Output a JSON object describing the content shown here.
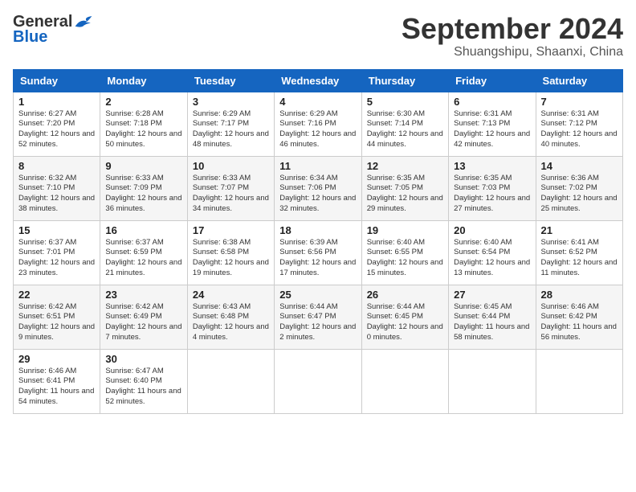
{
  "logo": {
    "general": "General",
    "blue": "Blue"
  },
  "header": {
    "month": "September 2024",
    "location": "Shuangshipu, Shaanxi, China"
  },
  "weekdays": [
    "Sunday",
    "Monday",
    "Tuesday",
    "Wednesday",
    "Thursday",
    "Friday",
    "Saturday"
  ],
  "weeks": [
    [
      {
        "day": "1",
        "sunrise": "6:27 AM",
        "sunset": "7:20 PM",
        "daylight": "12 hours and 52 minutes."
      },
      {
        "day": "2",
        "sunrise": "6:28 AM",
        "sunset": "7:18 PM",
        "daylight": "12 hours and 50 minutes."
      },
      {
        "day": "3",
        "sunrise": "6:29 AM",
        "sunset": "7:17 PM",
        "daylight": "12 hours and 48 minutes."
      },
      {
        "day": "4",
        "sunrise": "6:29 AM",
        "sunset": "7:16 PM",
        "daylight": "12 hours and 46 minutes."
      },
      {
        "day": "5",
        "sunrise": "6:30 AM",
        "sunset": "7:14 PM",
        "daylight": "12 hours and 44 minutes."
      },
      {
        "day": "6",
        "sunrise": "6:31 AM",
        "sunset": "7:13 PM",
        "daylight": "12 hours and 42 minutes."
      },
      {
        "day": "7",
        "sunrise": "6:31 AM",
        "sunset": "7:12 PM",
        "daylight": "12 hours and 40 minutes."
      }
    ],
    [
      {
        "day": "8",
        "sunrise": "6:32 AM",
        "sunset": "7:10 PM",
        "daylight": "12 hours and 38 minutes."
      },
      {
        "day": "9",
        "sunrise": "6:33 AM",
        "sunset": "7:09 PM",
        "daylight": "12 hours and 36 minutes."
      },
      {
        "day": "10",
        "sunrise": "6:33 AM",
        "sunset": "7:07 PM",
        "daylight": "12 hours and 34 minutes."
      },
      {
        "day": "11",
        "sunrise": "6:34 AM",
        "sunset": "7:06 PM",
        "daylight": "12 hours and 32 minutes."
      },
      {
        "day": "12",
        "sunrise": "6:35 AM",
        "sunset": "7:05 PM",
        "daylight": "12 hours and 29 minutes."
      },
      {
        "day": "13",
        "sunrise": "6:35 AM",
        "sunset": "7:03 PM",
        "daylight": "12 hours and 27 minutes."
      },
      {
        "day": "14",
        "sunrise": "6:36 AM",
        "sunset": "7:02 PM",
        "daylight": "12 hours and 25 minutes."
      }
    ],
    [
      {
        "day": "15",
        "sunrise": "6:37 AM",
        "sunset": "7:01 PM",
        "daylight": "12 hours and 23 minutes."
      },
      {
        "day": "16",
        "sunrise": "6:37 AM",
        "sunset": "6:59 PM",
        "daylight": "12 hours and 21 minutes."
      },
      {
        "day": "17",
        "sunrise": "6:38 AM",
        "sunset": "6:58 PM",
        "daylight": "12 hours and 19 minutes."
      },
      {
        "day": "18",
        "sunrise": "6:39 AM",
        "sunset": "6:56 PM",
        "daylight": "12 hours and 17 minutes."
      },
      {
        "day": "19",
        "sunrise": "6:40 AM",
        "sunset": "6:55 PM",
        "daylight": "12 hours and 15 minutes."
      },
      {
        "day": "20",
        "sunrise": "6:40 AM",
        "sunset": "6:54 PM",
        "daylight": "12 hours and 13 minutes."
      },
      {
        "day": "21",
        "sunrise": "6:41 AM",
        "sunset": "6:52 PM",
        "daylight": "12 hours and 11 minutes."
      }
    ],
    [
      {
        "day": "22",
        "sunrise": "6:42 AM",
        "sunset": "6:51 PM",
        "daylight": "12 hours and 9 minutes."
      },
      {
        "day": "23",
        "sunrise": "6:42 AM",
        "sunset": "6:49 PM",
        "daylight": "12 hours and 7 minutes."
      },
      {
        "day": "24",
        "sunrise": "6:43 AM",
        "sunset": "6:48 PM",
        "daylight": "12 hours and 4 minutes."
      },
      {
        "day": "25",
        "sunrise": "6:44 AM",
        "sunset": "6:47 PM",
        "daylight": "12 hours and 2 minutes."
      },
      {
        "day": "26",
        "sunrise": "6:44 AM",
        "sunset": "6:45 PM",
        "daylight": "12 hours and 0 minutes."
      },
      {
        "day": "27",
        "sunrise": "6:45 AM",
        "sunset": "6:44 PM",
        "daylight": "11 hours and 58 minutes."
      },
      {
        "day": "28",
        "sunrise": "6:46 AM",
        "sunset": "6:42 PM",
        "daylight": "11 hours and 56 minutes."
      }
    ],
    [
      {
        "day": "29",
        "sunrise": "6:46 AM",
        "sunset": "6:41 PM",
        "daylight": "11 hours and 54 minutes."
      },
      {
        "day": "30",
        "sunrise": "6:47 AM",
        "sunset": "6:40 PM",
        "daylight": "11 hours and 52 minutes."
      },
      null,
      null,
      null,
      null,
      null
    ]
  ]
}
